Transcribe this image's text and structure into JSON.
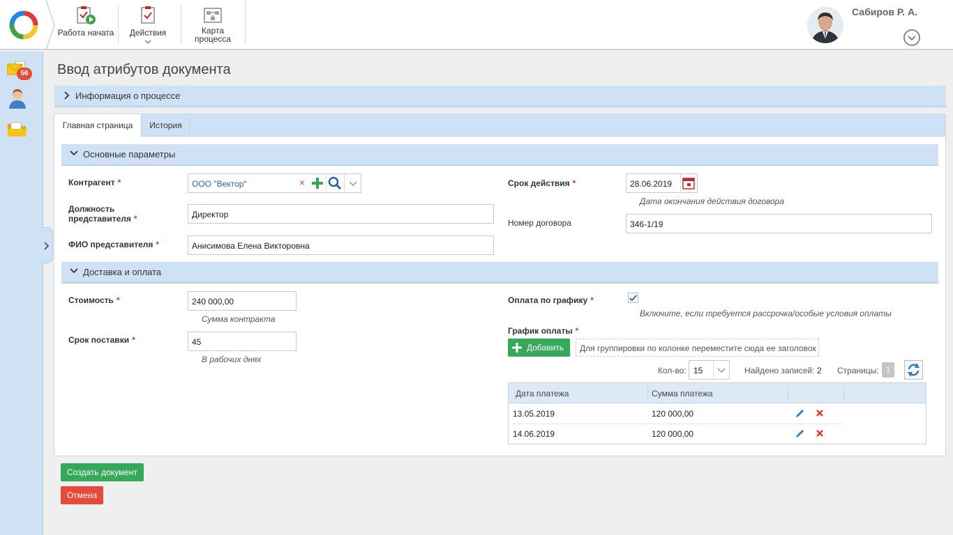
{
  "toolbar": {
    "work_started": "Работа начата",
    "actions": "Действия",
    "process_map": "Карта\nпроцесса"
  },
  "user": {
    "name": "Сабиров Р. А."
  },
  "sidebar": {
    "mail_count": "56"
  },
  "page": {
    "title": "Ввод атрибутов документа"
  },
  "process_info": {
    "label": "Информация о процессе"
  },
  "tabs": {
    "main": "Главная страница",
    "history": "История"
  },
  "sections": {
    "main_params": "Основные параметры",
    "delivery": "Доставка и оплата"
  },
  "fields": {
    "counterparty": {
      "label": "Контрагент",
      "value": "ООО \"Вектор\""
    },
    "position": {
      "label_1": "Должность",
      "label_2": "представителя",
      "value": "Директор"
    },
    "fio": {
      "label": "ФИО представителя",
      "value": "Анисимова Елена Викторовна"
    },
    "validity": {
      "label": "Срок действия",
      "value": "28.06.2019",
      "hint": "Дата окончания действия договора"
    },
    "contract_no": {
      "label": "Номер договора",
      "value": "346-1/19"
    },
    "cost": {
      "label": "Стоимость",
      "value": "240 000,00",
      "hint": "Сумма контракта"
    },
    "delivery_term": {
      "label": "Срок поставки",
      "value": "45",
      "hint": "В рабочих днях"
    },
    "pay_schedule_flag": {
      "label": "Оплата по графику",
      "hint": "Включите, если требуется рассрочка/особые условия оплаты"
    },
    "pay_schedule": {
      "label": "График оплаты"
    }
  },
  "grid": {
    "add_label": "Добавить",
    "group_hint": "Для группировки по колонке переместите сюда ее заголовок",
    "count_label": "Кол-во:",
    "count_value": "15",
    "found_label": "Найдено записей:",
    "found_value": "2",
    "pages_label": "Страницы:",
    "page_value": "1",
    "col_date": "Дата платежа",
    "col_sum": "Сумма платежа",
    "rows": [
      {
        "date": "13.05.2019",
        "sum": "120 000,00"
      },
      {
        "date": "14.06.2019",
        "sum": "120 000,00"
      }
    ]
  },
  "buttons": {
    "create": "Создать документ",
    "cancel": "Отмена"
  },
  "colors": {
    "accent": "#cfe1f5",
    "green": "#35a85a",
    "red": "#e64a3b"
  }
}
